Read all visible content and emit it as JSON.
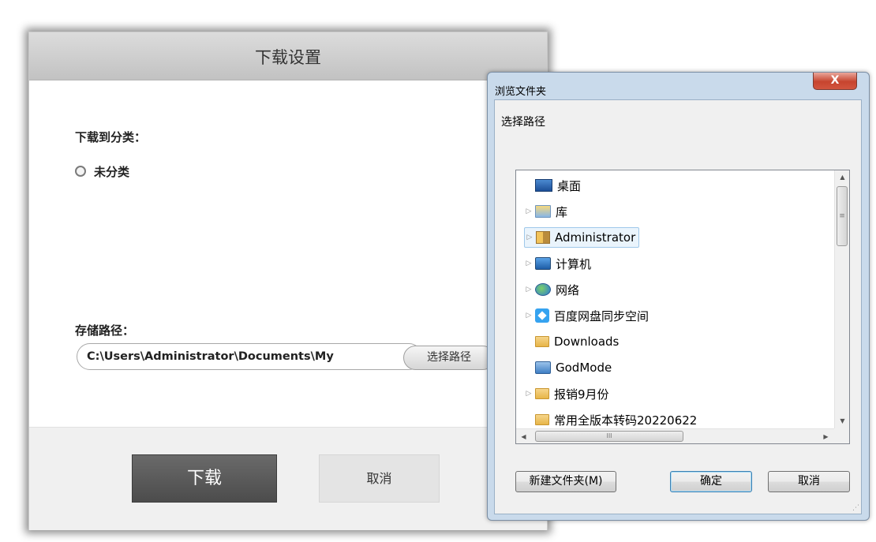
{
  "main_dialog": {
    "title": "下载设置",
    "category_label": "下载到分类：",
    "category_option": "未分类",
    "storage_label": "存储路径：",
    "path_value": "C:\\Users\\Administrator\\Documents\\My",
    "choose_path_label": "选择路径",
    "download_label": "下载",
    "cancel_label": "取消"
  },
  "browse_dialog": {
    "title": "浏览文件夹",
    "close_label": "X",
    "prompt": "选择路径",
    "tree": [
      {
        "label": "桌面",
        "icon": "desktop-icon",
        "expandable": false
      },
      {
        "label": "库",
        "icon": "library-icon",
        "expandable": true
      },
      {
        "label": "Administrator",
        "icon": "user-folder-icon",
        "expandable": true,
        "selected": true
      },
      {
        "label": "计算机",
        "icon": "computer-icon",
        "expandable": true
      },
      {
        "label": "网络",
        "icon": "network-icon",
        "expandable": true
      },
      {
        "label": "百度网盘同步空间",
        "icon": "baidu-netdisk-icon",
        "expandable": true
      },
      {
        "label": "Downloads",
        "icon": "folder-icon",
        "expandable": false
      },
      {
        "label": "GodMode",
        "icon": "godmode-icon",
        "expandable": false
      },
      {
        "label": "报销9月份",
        "icon": "folder-icon",
        "expandable": true
      },
      {
        "label": "常用全版本转码20220622",
        "icon": "folder-icon",
        "expandable": false
      }
    ],
    "scroll": {
      "up": "▲",
      "down": "▼",
      "left": "◀",
      "right": "▶",
      "thumb_v": "≡",
      "thumb_h": "III"
    },
    "new_folder_label": "新建文件夹(M)",
    "ok_label": "确定",
    "cancel_label": "取消",
    "grip": "⋰"
  }
}
